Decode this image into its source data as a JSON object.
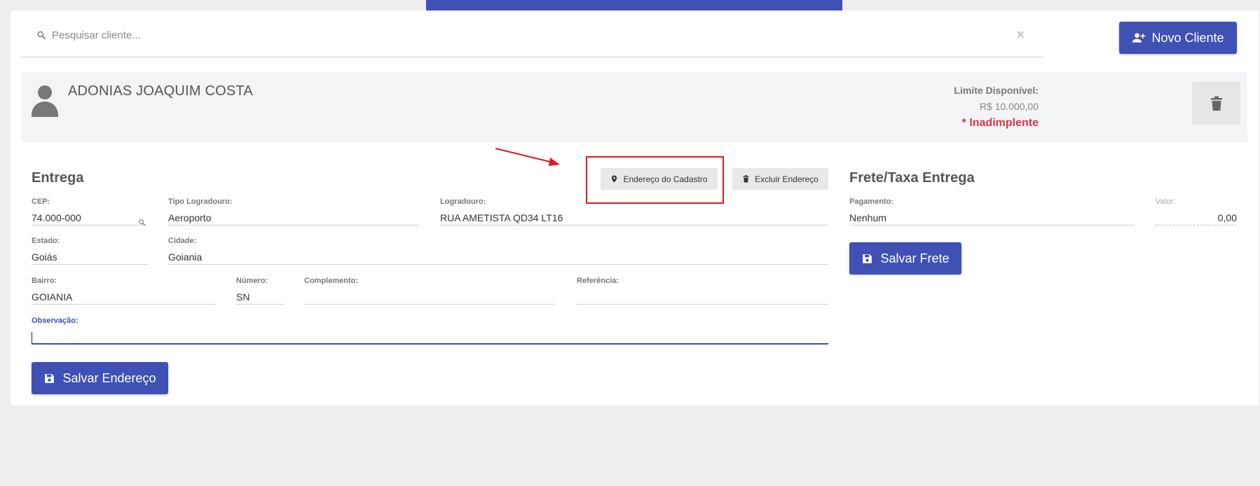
{
  "search": {
    "placeholder": "Pesquisar cliente..."
  },
  "header": {
    "novo_cliente_label": "Novo Cliente"
  },
  "client": {
    "name": "ADONIAS JOAQUIM COSTA",
    "limit_label": "Limite Disponível:",
    "limit_value": "R$ 10.000,00",
    "status": "* Inadimplente"
  },
  "entrega": {
    "title": "Entrega",
    "endereco_cadastro_label": "Endereço do Cadastro",
    "excluir_endereco_label": "Excluir Endereço",
    "fields": {
      "cep": {
        "label": "CEP:",
        "value": "74.000-000"
      },
      "tipo_logradouro": {
        "label": "Tipo Logradouro:",
        "value": "Aeroporto"
      },
      "logradouro": {
        "label": "Logradouro:",
        "value": "RUA AMETISTA QD34 LT16"
      },
      "estado": {
        "label": "Estado:",
        "value": "Goiás"
      },
      "cidade": {
        "label": "Cidade:",
        "value": "Goiania"
      },
      "bairro": {
        "label": "Bairro:",
        "value": "GOIANIA"
      },
      "numero": {
        "label": "Número:",
        "value": "SN"
      },
      "complemento": {
        "label": "Complemento:",
        "value": ""
      },
      "referencia": {
        "label": "Referência:",
        "value": ""
      },
      "observacao": {
        "label": "Observação:",
        "value": ""
      }
    },
    "salvar_label": "Salvar Endereço"
  },
  "frete": {
    "title": "Frete/Taxa Entrega",
    "pagamento": {
      "label": "Pagamento:",
      "value": "Nenhum"
    },
    "valor": {
      "label": "Valor:",
      "value": "0,00"
    },
    "salvar_label": "Salvar Frete"
  },
  "colors": {
    "primary": "#3f51b5",
    "danger": "#d9374a",
    "annotation": "#e0191e"
  },
  "icons": [
    "search-icon",
    "close-icon",
    "person-add-icon",
    "avatar-icon",
    "trash-icon",
    "map-marker-icon",
    "save-icon"
  ]
}
